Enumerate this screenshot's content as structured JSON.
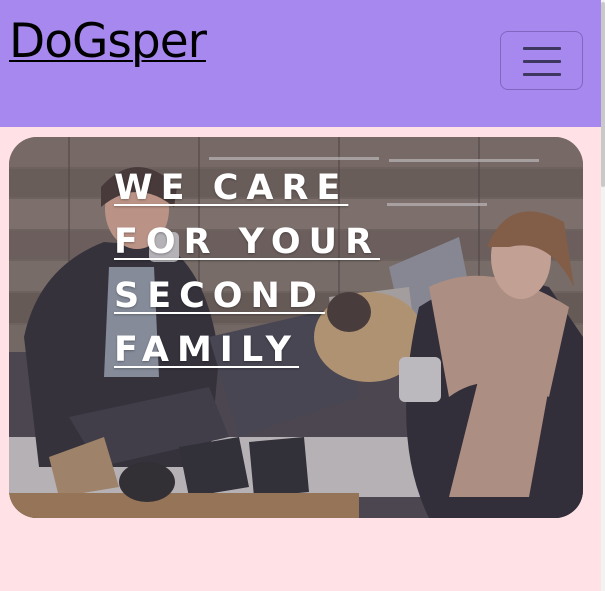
{
  "navbar": {
    "brand": "DoGsper",
    "toggler_icon": "hamburger-menu-icon",
    "background": "#a688ef"
  },
  "hero": {
    "headline_lines": [
      "WE CARE",
      "FOR YOUR",
      "SECOND",
      "FAMILY"
    ],
    "image": "photo-of-couple-with-pug-on-couch"
  },
  "page": {
    "background": "#ffe1e6"
  }
}
